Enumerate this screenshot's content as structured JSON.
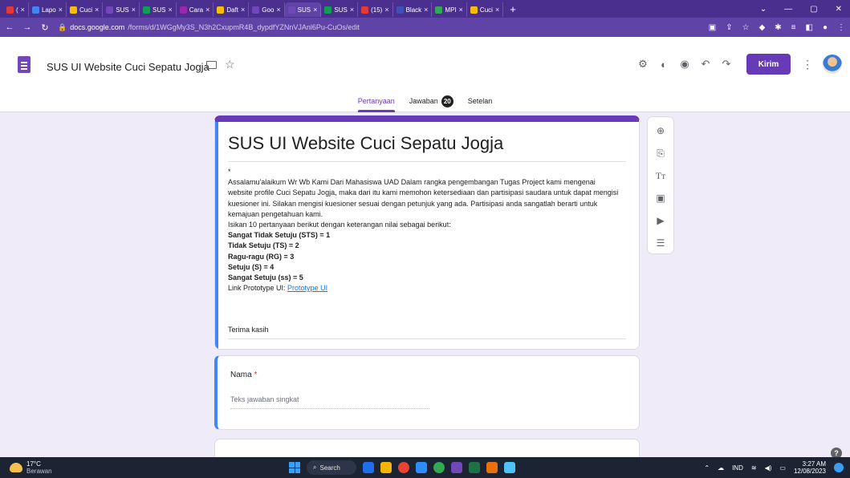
{
  "browser": {
    "tabs": [
      {
        "label": "(",
        "color": "#e53935"
      },
      {
        "label": "Lapo",
        "color": "#4285f4"
      },
      {
        "label": "Cuci",
        "color": "#fbbc04"
      },
      {
        "label": "SUS",
        "color": "#7248b9"
      },
      {
        "label": "SUS",
        "color": "#0f9d58"
      },
      {
        "label": "Cara",
        "color": "#9c27b0"
      },
      {
        "label": "Daft",
        "color": "#fbbc04"
      },
      {
        "label": "Goo",
        "color": "#7248b9"
      },
      {
        "label": "SUS",
        "color": "#7248b9",
        "active": true
      },
      {
        "label": "SUS",
        "color": "#0f9d58"
      },
      {
        "label": "(15)",
        "color": "#e53935"
      },
      {
        "label": "Black",
        "color": "#3f51b5"
      },
      {
        "label": "MPI",
        "color": "#34a853"
      },
      {
        "label": "Cuci",
        "color": "#fbbc04"
      }
    ],
    "new_tab": "+",
    "url_host": "docs.google.com",
    "url_path": "/forms/d/1WGgMy3S_N3h2CxupmR4B_dypdfYZNnVJAnl6Pu-CuOs/edit"
  },
  "header": {
    "title": "SUS UI Website Cuci Sepatu Jogja",
    "send_label": "Kirim",
    "tabs": [
      {
        "label": "Pertanyaan",
        "active": true
      },
      {
        "label": "Jawaban",
        "badge": "20"
      },
      {
        "label": "Setelan"
      }
    ]
  },
  "form": {
    "title": "SUS UI Website Cuci Sepatu Jogja",
    "asterisk": "*",
    "intro": "Assalamu'alaikum Wr Wb Kami Dari Mahasiswa UAD Dalam rangka pengembangan Tugas Project kami mengenai website profile Cuci Sepatu Jogja, maka dari itu kami memohon ketersediaan dan partisipasi saudara untuk dapat mengisi kuesioner ini. Silakan mengisi kuesioner sesuai dengan petunjuk yang ada. Partisipasi anda sangatlah berarti untuk kemajuan pengetahuan kami.",
    "scale_intro": "Isikan 10 pertanyaan berikut dengan keterangan nilai sebagai berikut:",
    "scale": [
      "Sangat Tidak Setuju (STS) = 1",
      "Tidak Setuju (TS) = 2",
      "Ragu-ragu (RG) = 3",
      "Setuju (S) = 4",
      "Sangat Setuju (ss) = 5"
    ],
    "link_prefix": "Link Prototype UI: ",
    "link_text": "Prototype UI",
    "thanks": "Terima kasih",
    "question_label": "Nama",
    "question_required": "*",
    "question_placeholder": "Teks jawaban singkat"
  },
  "taskbar": {
    "temperature": "17°C",
    "weather": "Berawan",
    "search": "Search",
    "language": "IND",
    "time": "3:27 AM",
    "date": "12/08/2023"
  },
  "colors": {
    "accent": "#673ab7",
    "focus": "#4285f4",
    "background": "#f0ebf8"
  }
}
